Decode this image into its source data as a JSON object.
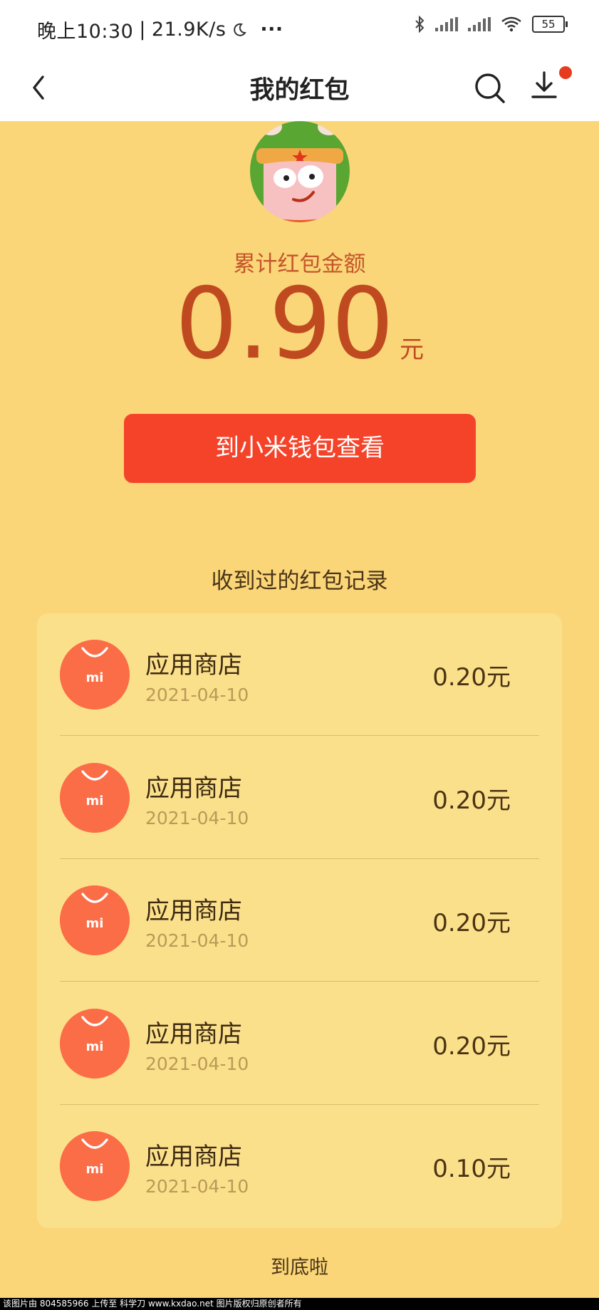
{
  "status_bar": {
    "time": "晚上10:30",
    "network_speed": "21.9K/s",
    "separator": "|",
    "more": "···",
    "battery": "55",
    "icons": [
      "moon-icon",
      "bluetooth-icon",
      "signal-icon",
      "signal-icon",
      "wifi-icon",
      "battery-icon"
    ]
  },
  "header": {
    "title": "我的红包",
    "back_icon": "back-chevron-icon",
    "search_icon": "search-icon",
    "download_icon": "download-icon",
    "has_badge": true
  },
  "summary": {
    "label": "累计红包金额",
    "amount": "0.90",
    "unit": "元",
    "wallet_button": "到小米钱包查看"
  },
  "records": {
    "title": "收到过的红包记录",
    "items": [
      {
        "name": "应用商店",
        "date": "2021-04-10",
        "amount": "0.20元"
      },
      {
        "name": "应用商店",
        "date": "2021-04-10",
        "amount": "0.20元"
      },
      {
        "name": "应用商店",
        "date": "2021-04-10",
        "amount": "0.20元"
      },
      {
        "name": "应用商店",
        "date": "2021-04-10",
        "amount": "0.20元"
      },
      {
        "name": "应用商店",
        "date": "2021-04-10",
        "amount": "0.10元"
      }
    ],
    "logo_text": "mi"
  },
  "footer": {
    "end_text": "到底啦"
  },
  "watermark": "该图片由 804585966 上传至 科学刀 www.kxdao.net 图片版权归原创者所有",
  "colors": {
    "background": "#fad679",
    "card": "#fbe08c",
    "accent_button": "#f5432a",
    "amount_text": "#c04a1f",
    "logo": "#fb6d46",
    "badge": "#e53b1f"
  }
}
